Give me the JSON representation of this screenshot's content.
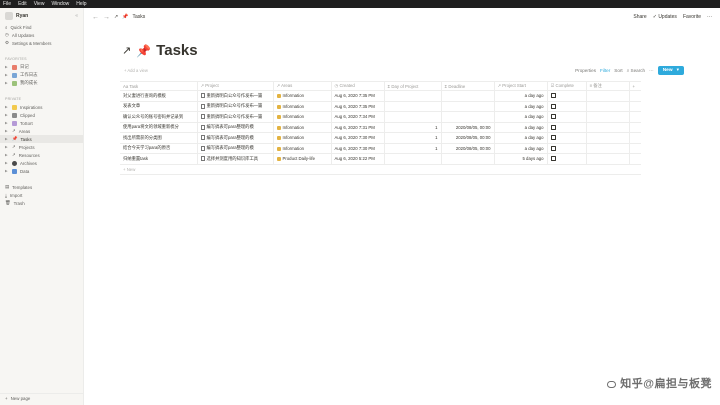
{
  "menubar": {
    "items": [
      "File",
      "Edit",
      "View",
      "Window",
      "Help"
    ]
  },
  "sidebar": {
    "workspace": "Ryan",
    "top_items": [
      "Quick Find",
      "All Updates",
      "Settings & Members"
    ],
    "favorites_label": "FAVORITES",
    "favorites": [
      "日记",
      "工作日志",
      "我的成长"
    ],
    "private_label": "PRIVATE",
    "private": [
      "Inspirations",
      "Clipped",
      "ToSort",
      "Areas",
      "Tasks",
      "Projects",
      "Resources",
      "Archives",
      "Data"
    ],
    "bottom": [
      "Templates",
      "Import",
      "Trash"
    ],
    "new_page": "New page"
  },
  "topbar": {
    "breadcrumb": "Tasks",
    "share": "Share",
    "updates": "Updates",
    "favorite": "Favorite",
    "more": "···"
  },
  "page": {
    "title": "Tasks",
    "add_view": "Add a view",
    "properties": "Properties",
    "filter": "Filter",
    "sort": "Sort",
    "search": "Search",
    "more": "···",
    "new_button": "New",
    "new_row": "+ New",
    "add_col": "+"
  },
  "columns": [
    "Task",
    "Project",
    "Areas",
    "Created",
    "Day of Project",
    "Deadline",
    "Project Start",
    "Complete",
    "备注"
  ],
  "rows": [
    {
      "task": "对父妻进行查询的模板",
      "project": "重新搞明白公众号作发布一篇",
      "area": "Information",
      "created": "Aug 6, 2020 7:35 PM",
      "day": "",
      "deadline": "",
      "start": "a day ago"
    },
    {
      "task": "发表文章",
      "project": "重新搞明白公众号作发布一篇",
      "area": "Information",
      "created": "Aug 6, 2020 7:35 PM",
      "day": "",
      "deadline": "",
      "start": "a day ago"
    },
    {
      "task": "确认公众号的账号密码并记录到",
      "project": "重新搞明白公众号作发布一篇",
      "area": "Information",
      "created": "Aug 6, 2020 7:34 PM",
      "day": "",
      "deadline": "",
      "start": "a day ago"
    },
    {
      "task": "使用para将文的领域重新梳分",
      "project": "编写搞表可para整理的模",
      "area": "Information",
      "created": "Aug 6, 2020 7:31 PM",
      "day": "1",
      "deadline": "2020/08/05, 00:00",
      "start": "a day ago"
    },
    {
      "task": "找出所需获的分类图",
      "project": "编写搞表可para整理的模",
      "area": "Information",
      "created": "Aug 6, 2020 7:30 PM",
      "day": "1",
      "deadline": "2020/08/05, 00:00",
      "start": "a day ago"
    },
    {
      "task": "结合今天学习para的原否",
      "project": "编写搞表可para整理的模",
      "area": "Information",
      "created": "Aug 6, 2020 7:30 PM",
      "day": "1",
      "deadline": "2020/08/05, 00:00",
      "start": "a day ago"
    },
    {
      "task": "归纳重置task",
      "project": "选择并测度用的知识库工具",
      "area": "Product   Daily-life",
      "created": "Aug 6, 2020 5:22 PM",
      "day": "",
      "deadline": "",
      "start": "5 days ago"
    }
  ],
  "watermark": "知乎@扁担与板凳",
  "colors": {
    "accent": "#2eaadc",
    "pin": "#e03e3e"
  }
}
